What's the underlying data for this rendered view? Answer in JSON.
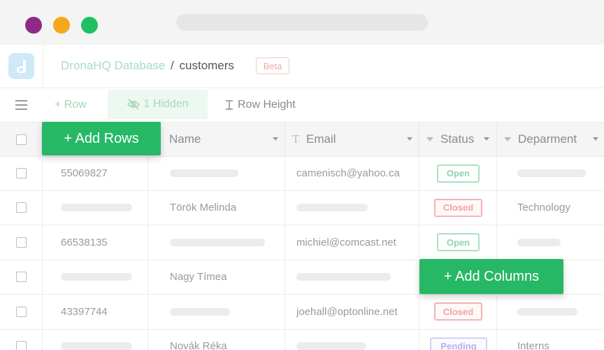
{
  "window": {
    "traffic_lights": [
      "#8e2a86",
      "#f4a81c",
      "#1fbf62"
    ]
  },
  "app": {
    "breadcrumb_db": "DronaHQ Database",
    "breadcrumb_sep": "/",
    "breadcrumb_table": "customers",
    "beta_label": "Beta"
  },
  "toolbar": {
    "row_label": "+ Row",
    "hidden_label": "1 Hidden",
    "row_height_label": "Row Height"
  },
  "columns": {
    "name": "Name",
    "email": "Email",
    "status": "Status",
    "department": "Deparment"
  },
  "rows": [
    {
      "id": "55069827",
      "name": "",
      "email": "camenisch@yahoo.ca",
      "status": "Open",
      "department": ""
    },
    {
      "id": "",
      "name": "Török Melinda",
      "email": "",
      "status": "Closed",
      "department": "Technology"
    },
    {
      "id": "66538135",
      "name": "",
      "email": "michiel@comcast.net",
      "status": "Open",
      "department": ""
    },
    {
      "id": "",
      "name": "Nagy Tímea",
      "email": "",
      "status": "",
      "department": ""
    },
    {
      "id": "43397744",
      "name": "",
      "email": "joehall@optonline.net",
      "status": "Closed",
      "department": ""
    },
    {
      "id": "",
      "name": "Novák Réka",
      "email": "",
      "status": "Pending",
      "department": "Interns"
    }
  ],
  "overlays": {
    "add_rows": "+ Add Rows",
    "add_columns": "+ Add Columns"
  },
  "colors": {
    "accent": "#27b866",
    "open": "#8fd3ad",
    "closed": "#f0a3a3",
    "pending": "#b9b0ee"
  }
}
